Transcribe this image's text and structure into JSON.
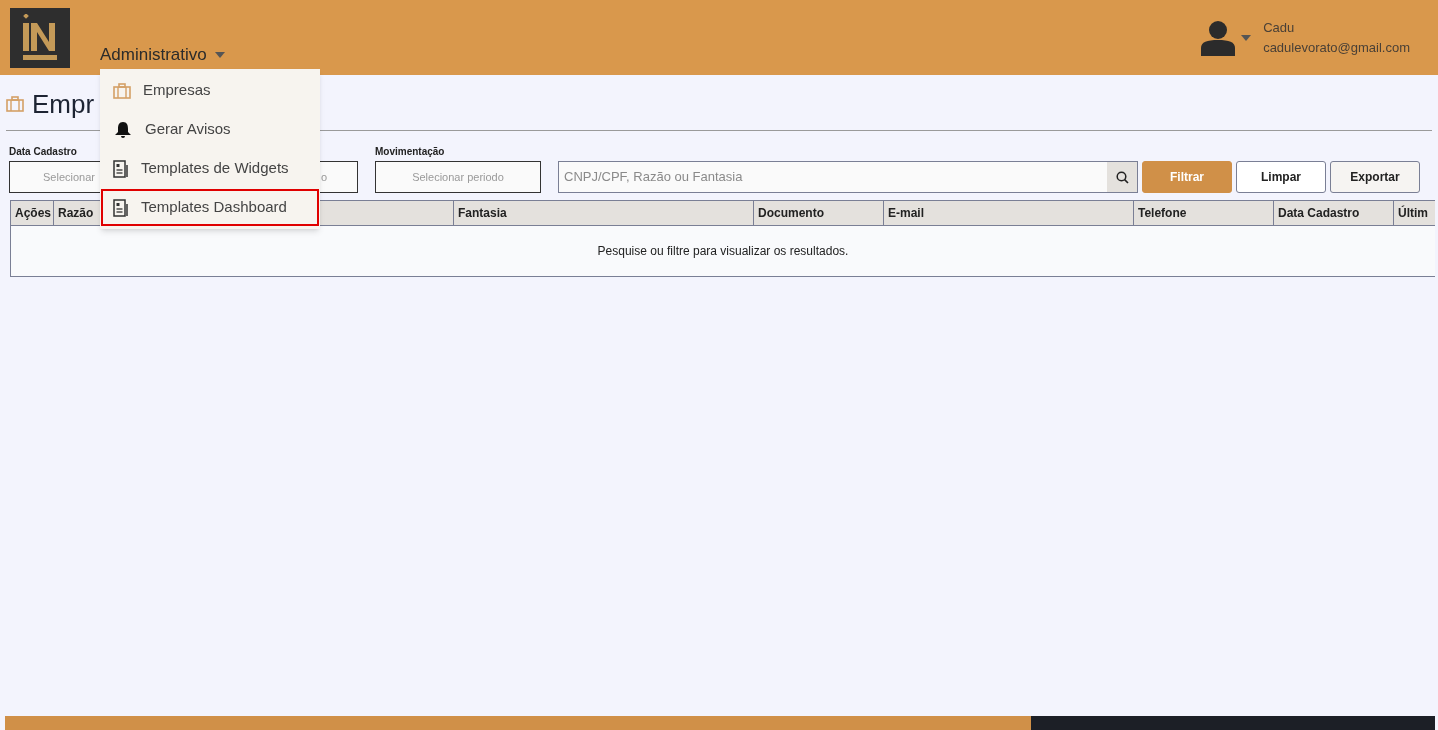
{
  "header": {
    "nav_menu": {
      "label": "Administrativo",
      "expanded": true,
      "items": [
        {
          "label": "Empresas",
          "kind": "briefcase",
          "selected": false
        },
        {
          "label": "Gerar Avisos",
          "kind": "bell",
          "selected": false
        },
        {
          "label": "Templates de Widgets",
          "kind": "document",
          "selected": false
        },
        {
          "label": "Templates Dashboard",
          "kind": "document",
          "selected": true
        }
      ]
    },
    "user": {
      "name": "Cadu",
      "email": "cadulevorato@gmail.com"
    }
  },
  "page_title": "Empr",
  "filters": [
    {
      "label": "Data Cadastro",
      "text_start": "Selecionar",
      "text_end": "o"
    },
    {
      "label": "Movimentação",
      "placeholder": "Selecionar periodo"
    }
  ],
  "search": {
    "placeholder": "CNPJ/CPF, Razão ou Fantasia"
  },
  "buttons": [
    {
      "label": "Filtrar",
      "kind": "primary"
    },
    {
      "label": "Limpar",
      "kind": "plain"
    },
    {
      "label": "Exportar",
      "kind": "muted"
    }
  ],
  "table": {
    "columns": [
      "Ações",
      "Razão",
      "Fantasia",
      "Documento",
      "E-mail",
      "Telefone",
      "Data Cadastro",
      "Últim"
    ],
    "empty_message": "Pesquise ou filtre para visualizar os resultados."
  }
}
